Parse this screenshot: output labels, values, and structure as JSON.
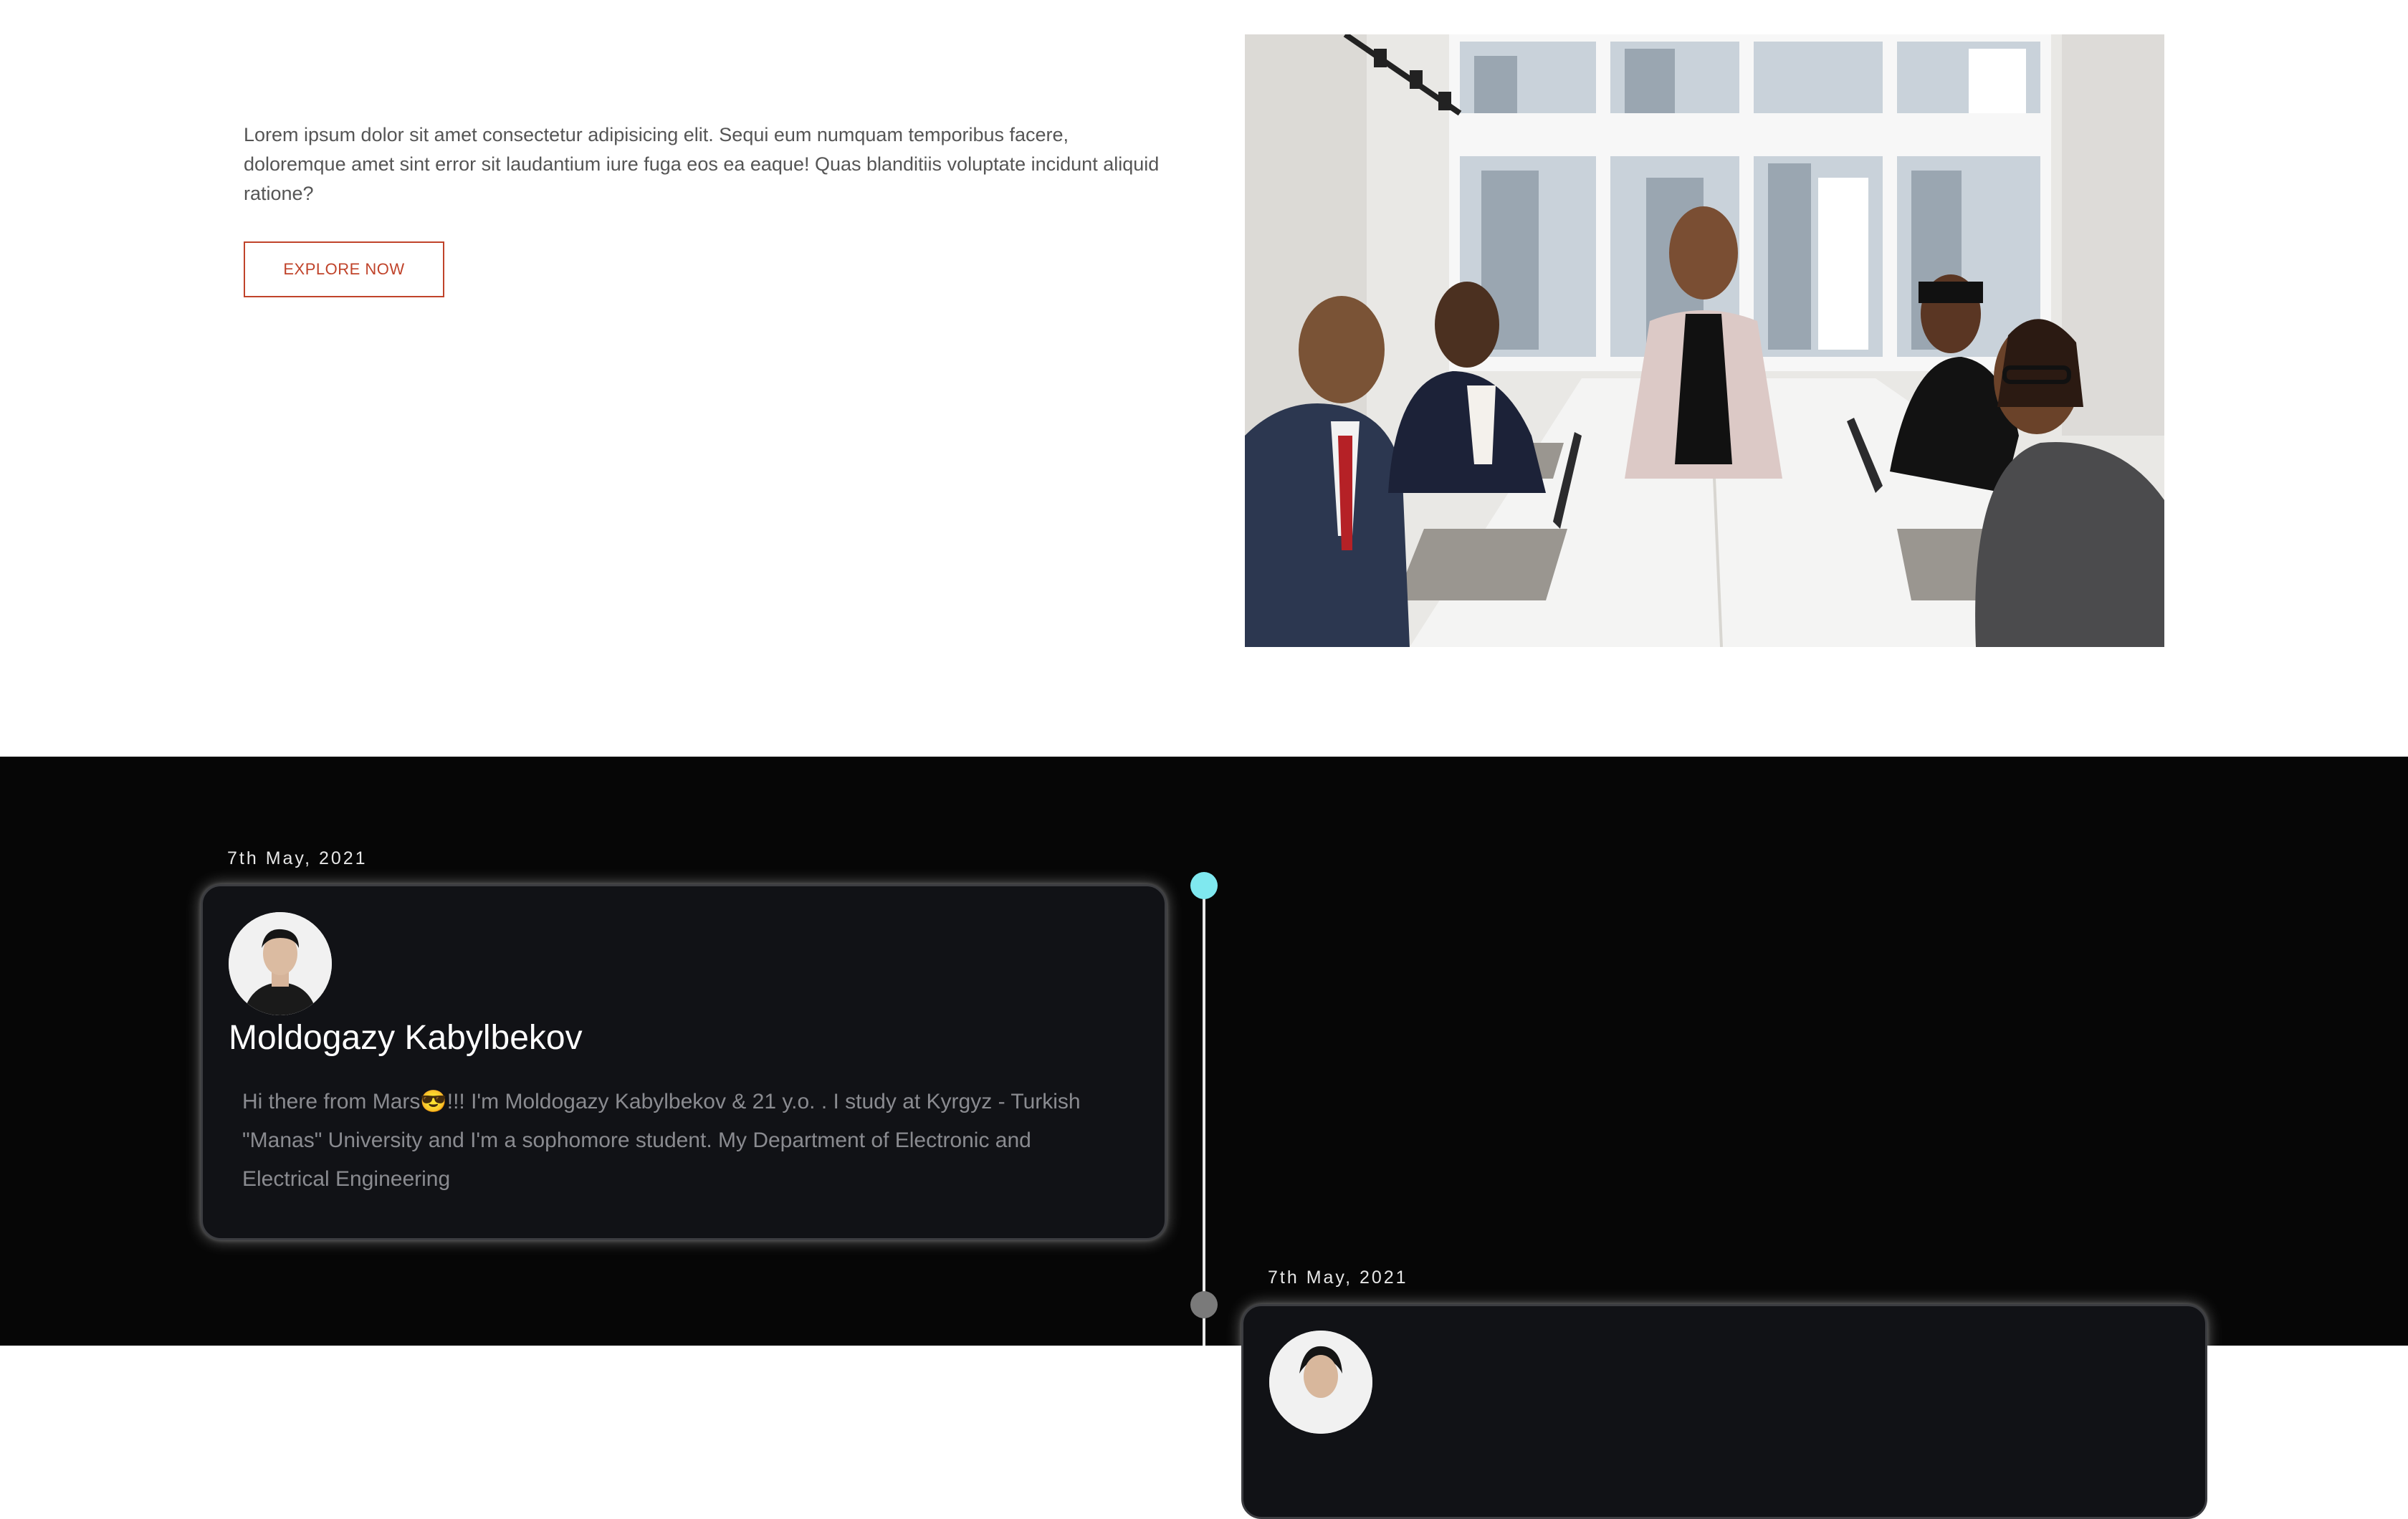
{
  "hero": {
    "description": "Lorem ipsum dolor sit amet consectetur adipisicing elit. Sequi eum numquam temporibus facere, doloremque amet sint error sit laudantium iure fuga eos ea eaque! Quas blanditiis voluptate incidunt aliquid ratione?",
    "cta_label": "EXPLORE NOW",
    "accent_color": "#c0432a",
    "image_icon": "team-meeting-photo"
  },
  "timeline": {
    "background_color": "#060606",
    "active_dot_color": "#7fe8ef",
    "entries": [
      {
        "date": "7th May, 2021",
        "name": "Moldogazy Kabylbekov",
        "bio": "Hi there from Mars😎!!! I'm Moldogazy Kabylbekov & 21 y.o. . I study at Kyrgyz - Turkish \"Manas\" University and I'm a sophomore student. My Department of Electronic and Electrical Engineering",
        "avatar_icon": "user-avatar"
      },
      {
        "date": "7th May, 2021",
        "avatar_icon": "user-avatar"
      }
    ]
  }
}
